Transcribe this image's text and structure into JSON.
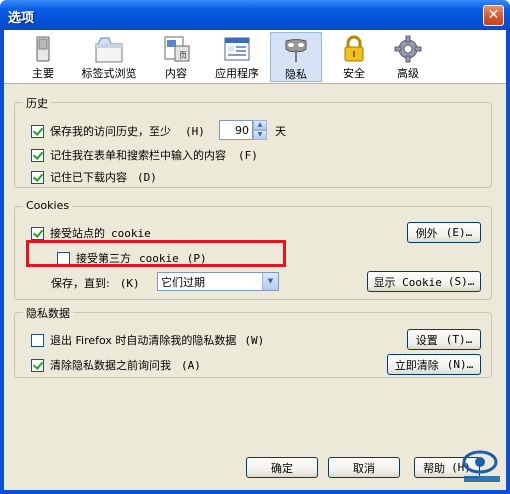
{
  "window": {
    "title": "选项",
    "close_glyph": "✕"
  },
  "toolbar": {
    "items": [
      {
        "label": "主要",
        "icon": "switch-icon"
      },
      {
        "label": "标签式浏览",
        "icon": "tab-window-icon"
      },
      {
        "label": "内容",
        "icon": "content-page-icon"
      },
      {
        "label": "应用程序",
        "icon": "application-window-icon"
      },
      {
        "label": "隐私",
        "icon": "privacy-mask-icon"
      },
      {
        "label": "安全",
        "icon": "padlock-icon"
      },
      {
        "label": "高级",
        "icon": "gear-icon"
      }
    ],
    "active_index": 4
  },
  "history": {
    "title": "历史",
    "keep_history_label": "保存我的访问历史，至少",
    "keep_history_key": "(H)",
    "days_value": "90",
    "days_unit": "天",
    "remember_forms_label": "记住我在表单和搜索栏中输入的内容",
    "remember_forms_key": "(F)",
    "remember_downloads_label": "记住已下载内容",
    "remember_downloads_key": "(D)",
    "keep_history_checked": true,
    "remember_forms_checked": true,
    "remember_downloads_checked": true
  },
  "cookies": {
    "title": "Cookies",
    "accept_label": "接受站点的",
    "accept_word": "cookie",
    "accept_checked": true,
    "exceptions_button": "例外",
    "exceptions_key": "(E)…",
    "third_party_label": "接受第三方",
    "third_party_word": "cookie",
    "third_party_key": "(P)",
    "third_party_checked": false,
    "keep_until_label": "保存，直到:",
    "keep_until_key": "(K)",
    "keep_until_value": "它们过期",
    "show_cookies_button": "显示 Cookie",
    "show_cookies_key": "(S)…"
  },
  "private_data": {
    "title": "隐私数据",
    "clear_on_exit_label": "退出 Firefox 时自动清除我的隐私数据",
    "clear_on_exit_key": "(W)",
    "clear_on_exit_checked": false,
    "ask_before_label": "清除隐私数据之前询问我",
    "ask_before_key": "(A)",
    "ask_before_checked": true,
    "settings_button": "设置",
    "settings_key": "(T)…",
    "clear_now_button": "立即清除",
    "clear_now_key": "(N)…"
  },
  "footer": {
    "ok_button": "确定",
    "cancel_button": "取消",
    "help_button": "帮助",
    "help_key": "(H)"
  },
  "colors": {
    "titlebar": "#0a5ee6",
    "dialog_bg": "#ece9d8",
    "highlight_border": "#e3171b",
    "checkmark": "#21a121"
  }
}
